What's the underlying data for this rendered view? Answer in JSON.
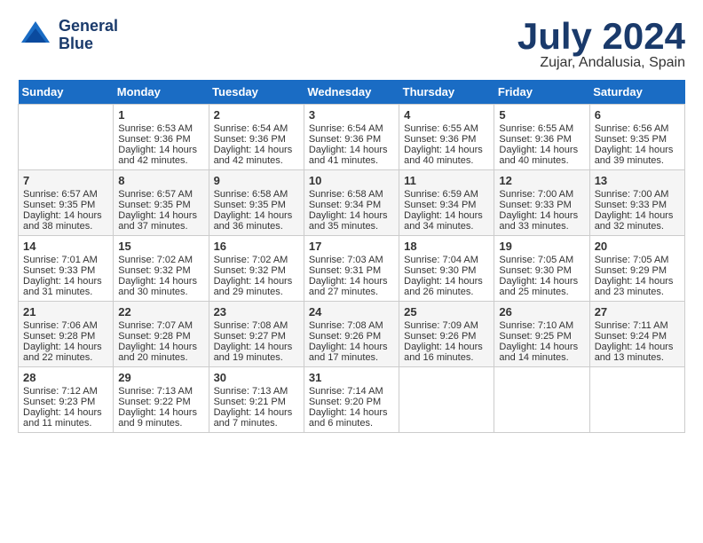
{
  "header": {
    "logo_line1": "General",
    "logo_line2": "Blue",
    "month_title": "July 2024",
    "location": "Zujar, Andalusia, Spain"
  },
  "days_of_week": [
    "Sunday",
    "Monday",
    "Tuesday",
    "Wednesday",
    "Thursday",
    "Friday",
    "Saturday"
  ],
  "weeks": [
    [
      {
        "day": "",
        "sunrise": "",
        "sunset": "",
        "daylight": ""
      },
      {
        "day": "1",
        "sunrise": "Sunrise: 6:53 AM",
        "sunset": "Sunset: 9:36 PM",
        "daylight": "Daylight: 14 hours and 42 minutes."
      },
      {
        "day": "2",
        "sunrise": "Sunrise: 6:54 AM",
        "sunset": "Sunset: 9:36 PM",
        "daylight": "Daylight: 14 hours and 42 minutes."
      },
      {
        "day": "3",
        "sunrise": "Sunrise: 6:54 AM",
        "sunset": "Sunset: 9:36 PM",
        "daylight": "Daylight: 14 hours and 41 minutes."
      },
      {
        "day": "4",
        "sunrise": "Sunrise: 6:55 AM",
        "sunset": "Sunset: 9:36 PM",
        "daylight": "Daylight: 14 hours and 40 minutes."
      },
      {
        "day": "5",
        "sunrise": "Sunrise: 6:55 AM",
        "sunset": "Sunset: 9:36 PM",
        "daylight": "Daylight: 14 hours and 40 minutes."
      },
      {
        "day": "6",
        "sunrise": "Sunrise: 6:56 AM",
        "sunset": "Sunset: 9:35 PM",
        "daylight": "Daylight: 14 hours and 39 minutes."
      }
    ],
    [
      {
        "day": "7",
        "sunrise": "Sunrise: 6:57 AM",
        "sunset": "Sunset: 9:35 PM",
        "daylight": "Daylight: 14 hours and 38 minutes."
      },
      {
        "day": "8",
        "sunrise": "Sunrise: 6:57 AM",
        "sunset": "Sunset: 9:35 PM",
        "daylight": "Daylight: 14 hours and 37 minutes."
      },
      {
        "day": "9",
        "sunrise": "Sunrise: 6:58 AM",
        "sunset": "Sunset: 9:35 PM",
        "daylight": "Daylight: 14 hours and 36 minutes."
      },
      {
        "day": "10",
        "sunrise": "Sunrise: 6:58 AM",
        "sunset": "Sunset: 9:34 PM",
        "daylight": "Daylight: 14 hours and 35 minutes."
      },
      {
        "day": "11",
        "sunrise": "Sunrise: 6:59 AM",
        "sunset": "Sunset: 9:34 PM",
        "daylight": "Daylight: 14 hours and 34 minutes."
      },
      {
        "day": "12",
        "sunrise": "Sunrise: 7:00 AM",
        "sunset": "Sunset: 9:33 PM",
        "daylight": "Daylight: 14 hours and 33 minutes."
      },
      {
        "day": "13",
        "sunrise": "Sunrise: 7:00 AM",
        "sunset": "Sunset: 9:33 PM",
        "daylight": "Daylight: 14 hours and 32 minutes."
      }
    ],
    [
      {
        "day": "14",
        "sunrise": "Sunrise: 7:01 AM",
        "sunset": "Sunset: 9:33 PM",
        "daylight": "Daylight: 14 hours and 31 minutes."
      },
      {
        "day": "15",
        "sunrise": "Sunrise: 7:02 AM",
        "sunset": "Sunset: 9:32 PM",
        "daylight": "Daylight: 14 hours and 30 minutes."
      },
      {
        "day": "16",
        "sunrise": "Sunrise: 7:02 AM",
        "sunset": "Sunset: 9:32 PM",
        "daylight": "Daylight: 14 hours and 29 minutes."
      },
      {
        "day": "17",
        "sunrise": "Sunrise: 7:03 AM",
        "sunset": "Sunset: 9:31 PM",
        "daylight": "Daylight: 14 hours and 27 minutes."
      },
      {
        "day": "18",
        "sunrise": "Sunrise: 7:04 AM",
        "sunset": "Sunset: 9:30 PM",
        "daylight": "Daylight: 14 hours and 26 minutes."
      },
      {
        "day": "19",
        "sunrise": "Sunrise: 7:05 AM",
        "sunset": "Sunset: 9:30 PM",
        "daylight": "Daylight: 14 hours and 25 minutes."
      },
      {
        "day": "20",
        "sunrise": "Sunrise: 7:05 AM",
        "sunset": "Sunset: 9:29 PM",
        "daylight": "Daylight: 14 hours and 23 minutes."
      }
    ],
    [
      {
        "day": "21",
        "sunrise": "Sunrise: 7:06 AM",
        "sunset": "Sunset: 9:28 PM",
        "daylight": "Daylight: 14 hours and 22 minutes."
      },
      {
        "day": "22",
        "sunrise": "Sunrise: 7:07 AM",
        "sunset": "Sunset: 9:28 PM",
        "daylight": "Daylight: 14 hours and 20 minutes."
      },
      {
        "day": "23",
        "sunrise": "Sunrise: 7:08 AM",
        "sunset": "Sunset: 9:27 PM",
        "daylight": "Daylight: 14 hours and 19 minutes."
      },
      {
        "day": "24",
        "sunrise": "Sunrise: 7:08 AM",
        "sunset": "Sunset: 9:26 PM",
        "daylight": "Daylight: 14 hours and 17 minutes."
      },
      {
        "day": "25",
        "sunrise": "Sunrise: 7:09 AM",
        "sunset": "Sunset: 9:26 PM",
        "daylight": "Daylight: 14 hours and 16 minutes."
      },
      {
        "day": "26",
        "sunrise": "Sunrise: 7:10 AM",
        "sunset": "Sunset: 9:25 PM",
        "daylight": "Daylight: 14 hours and 14 minutes."
      },
      {
        "day": "27",
        "sunrise": "Sunrise: 7:11 AM",
        "sunset": "Sunset: 9:24 PM",
        "daylight": "Daylight: 14 hours and 13 minutes."
      }
    ],
    [
      {
        "day": "28",
        "sunrise": "Sunrise: 7:12 AM",
        "sunset": "Sunset: 9:23 PM",
        "daylight": "Daylight: 14 hours and 11 minutes."
      },
      {
        "day": "29",
        "sunrise": "Sunrise: 7:13 AM",
        "sunset": "Sunset: 9:22 PM",
        "daylight": "Daylight: 14 hours and 9 minutes."
      },
      {
        "day": "30",
        "sunrise": "Sunrise: 7:13 AM",
        "sunset": "Sunset: 9:21 PM",
        "daylight": "Daylight: 14 hours and 7 minutes."
      },
      {
        "day": "31",
        "sunrise": "Sunrise: 7:14 AM",
        "sunset": "Sunset: 9:20 PM",
        "daylight": "Daylight: 14 hours and 6 minutes."
      },
      {
        "day": "",
        "sunrise": "",
        "sunset": "",
        "daylight": ""
      },
      {
        "day": "",
        "sunrise": "",
        "sunset": "",
        "daylight": ""
      },
      {
        "day": "",
        "sunrise": "",
        "sunset": "",
        "daylight": ""
      }
    ]
  ]
}
